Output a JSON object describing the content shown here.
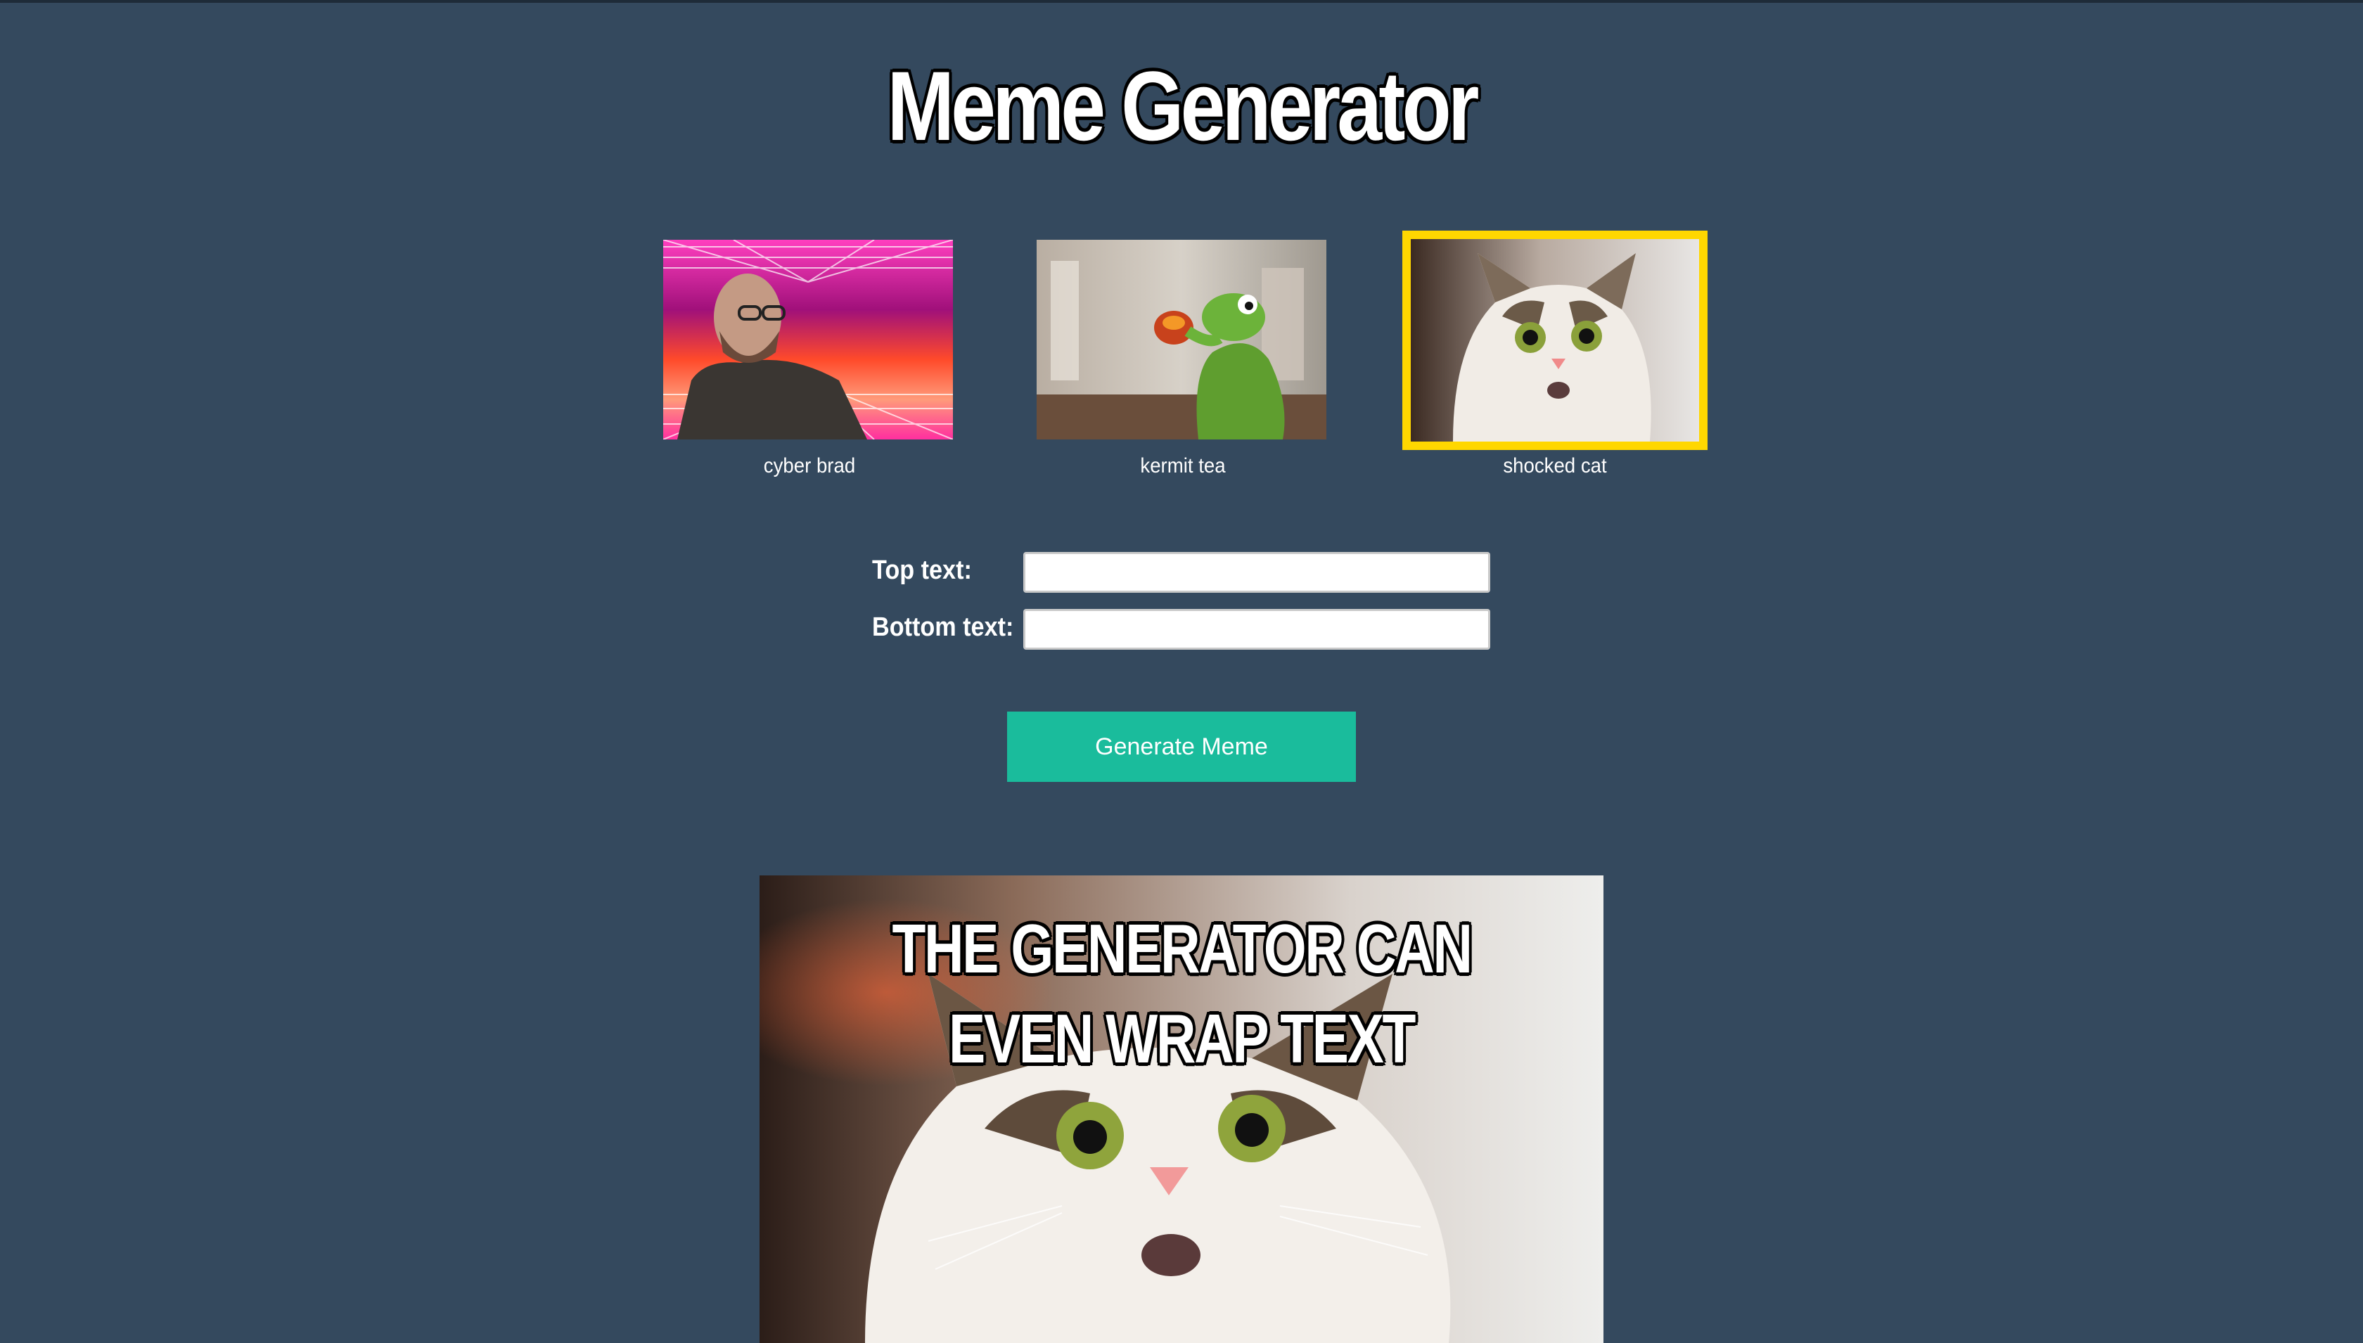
{
  "header": {
    "title": "Meme Generator"
  },
  "templates": [
    {
      "label": "cyber brad",
      "selected": false
    },
    {
      "label": "kermit tea",
      "selected": false
    },
    {
      "label": "shocked cat",
      "selected": true
    }
  ],
  "form": {
    "top_label": "Top text:",
    "top_value": "",
    "bottom_label": "Bottom text:",
    "bottom_value": ""
  },
  "actions": {
    "generate_label": "Generate Meme"
  },
  "meme": {
    "top_text": "THE GENERATOR CAN EVEN WRAP TEXT"
  },
  "colors": {
    "background": "#34495e",
    "selected_border": "#ffd700",
    "button": "#1abc9c"
  }
}
